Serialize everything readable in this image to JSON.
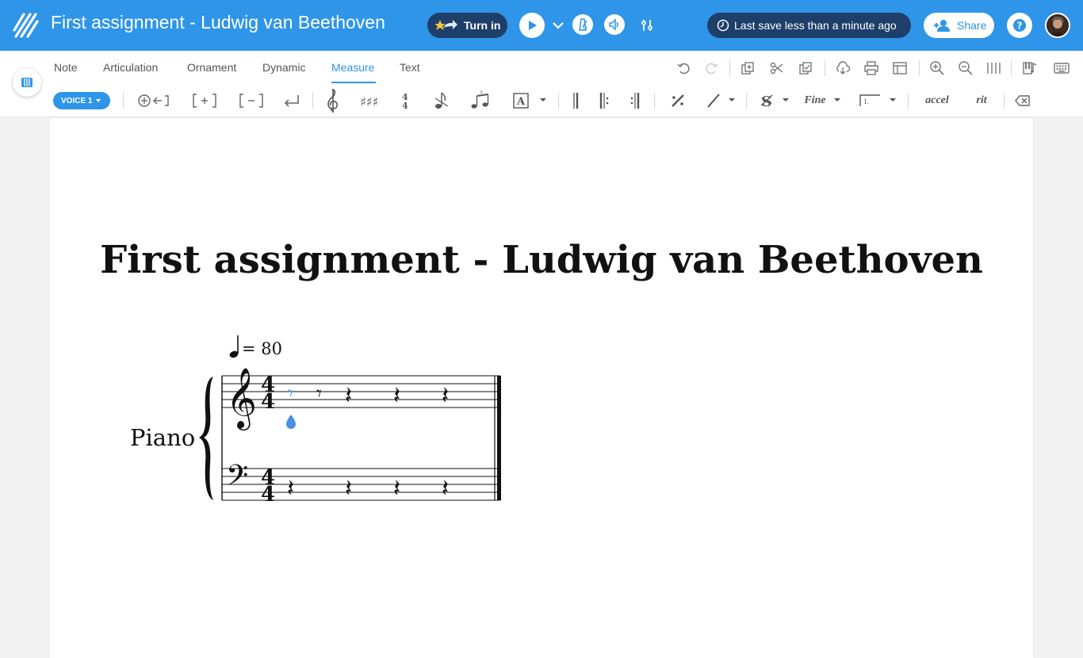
{
  "header": {
    "doc_title": "First assignment - Ludwig van Beethoven",
    "turn_in_label": "Turn in",
    "last_save_label": "Last save less than a minute ago",
    "share_label": "Share",
    "icons": [
      "flat-logo-icon",
      "turn-in-icon",
      "play-icon",
      "chevron-down-icon",
      "metronome-icon",
      "audio-icon",
      "mixer-icon",
      "clock-icon",
      "add-user-icon",
      "help-icon",
      "avatar"
    ]
  },
  "tabs": [
    {
      "label": "Note",
      "active": false
    },
    {
      "label": "Articulation",
      "active": false
    },
    {
      "label": "Ornament",
      "active": false
    },
    {
      "label": "Dynamic",
      "active": false
    },
    {
      "label": "Measure",
      "active": true
    },
    {
      "label": "Text",
      "active": false
    }
  ],
  "toolbar": {
    "voice_label": "VOICE 1",
    "fine_label": "Fine",
    "volta_label": "1.",
    "accel_label": "accel",
    "rit_label": "rit"
  },
  "score": {
    "title": "First assignment - Ludwig van Beethoven",
    "tempo_value": "= 80",
    "instrument": "Piano",
    "time_signature": "4/4"
  },
  "colors": {
    "accent": "#2f95e8",
    "header_bg": "#2f95e8",
    "dark_pill": "#1e3f6a"
  }
}
